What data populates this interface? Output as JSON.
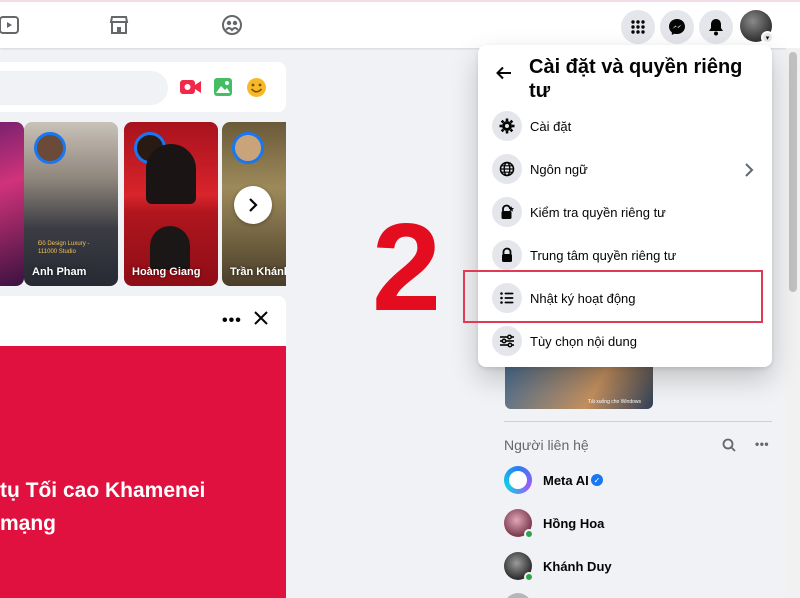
{
  "menu": {
    "title": "Cài đặt và quyền riêng tư",
    "items": [
      {
        "label": "Cài đặt",
        "icon": "gear-icon"
      },
      {
        "label": "Ngôn ngữ",
        "icon": "globe-icon"
      },
      {
        "label": "Kiểm tra quyền riêng tư",
        "icon": "lock-check-icon"
      },
      {
        "label": "Trung tâm quyền riêng tư",
        "icon": "lock-icon"
      },
      {
        "label": "Nhật ký hoạt động",
        "icon": "list-icon"
      },
      {
        "label": "Tùy chọn nội dung",
        "icon": "sliders-icon"
      }
    ]
  },
  "annotation": {
    "step_number": "2",
    "highlight_color": "#e03b55",
    "number_color": "#e40d20"
  },
  "stories": [
    {
      "name": ""
    },
    {
      "name": "Anh Pham",
      "overlay": "Đồ Design Luxury - 111000 Studio"
    },
    {
      "name": "Hoàng Giang"
    },
    {
      "name": "Trần Khánh"
    }
  ],
  "post": {
    "headline_line1": "tụ Tối cao Khamenei",
    "headline_line2": "mạng",
    "background_color": "#e0113f"
  },
  "sponsor": {
    "tag": "Tải xuống cho Windows"
  },
  "contacts": {
    "title": "Người liên hệ",
    "items": [
      {
        "name": "Meta AI",
        "verified": true
      },
      {
        "name": "Hồng Hoa",
        "online": true
      },
      {
        "name": "Khánh Duy",
        "online": true
      }
    ]
  },
  "colors": {
    "brand_blue": "#1877f2",
    "online_green": "#31a24c"
  }
}
